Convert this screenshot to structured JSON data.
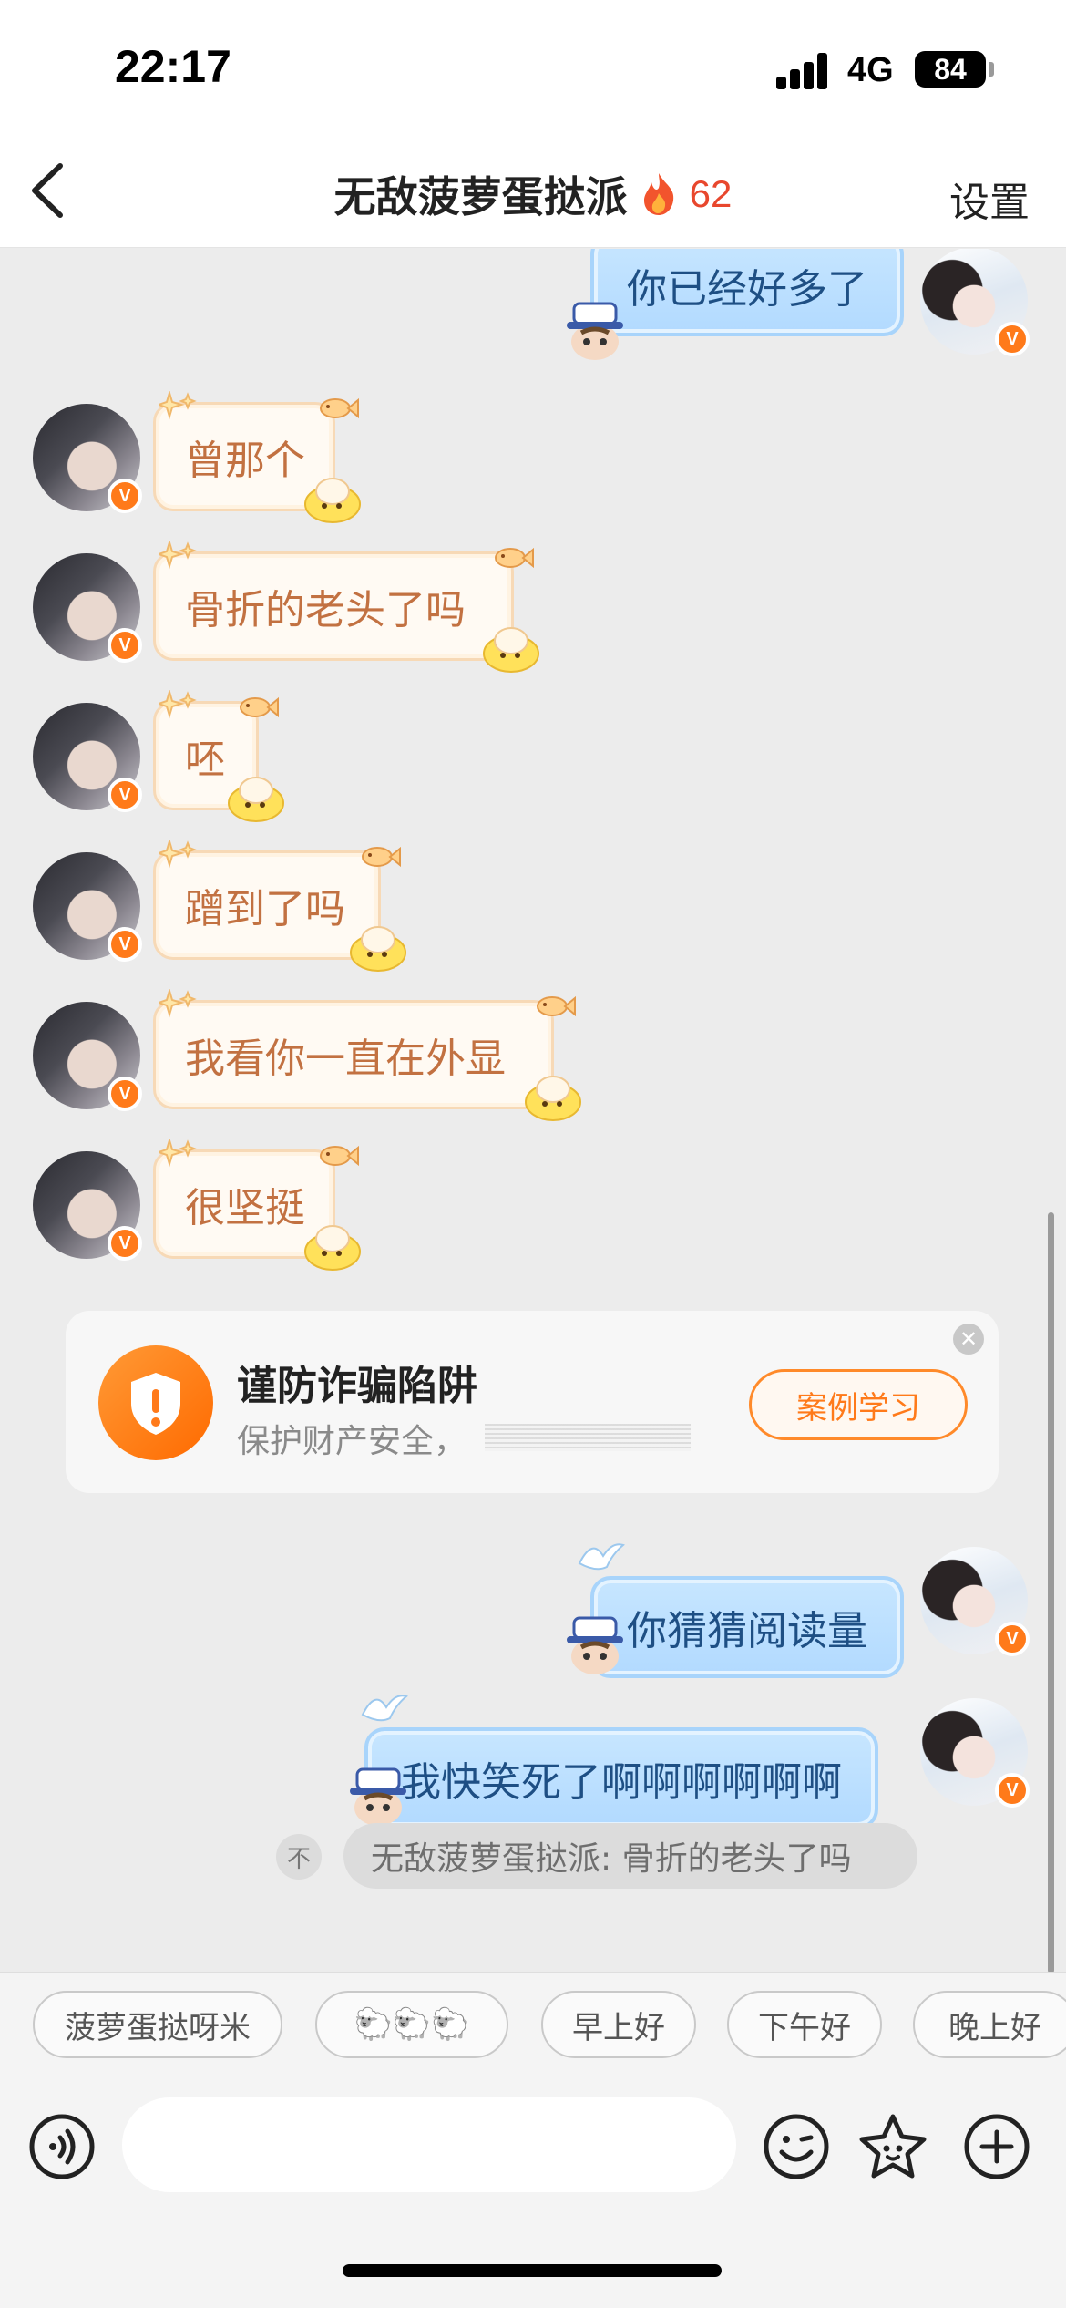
{
  "status_bar": {
    "time": "22:17",
    "network": "4G",
    "battery": "84"
  },
  "nav": {
    "back_icon": "chevron-left-icon",
    "title": "无敌菠萝蛋挞派",
    "fire_icon": "fire-icon",
    "streak": "62",
    "settings_label": "设置"
  },
  "messages": [
    {
      "side": "right",
      "text": "你已经好多了"
    },
    {
      "side": "left",
      "text": "曾那个"
    },
    {
      "side": "left",
      "text": "骨折的老头了吗"
    },
    {
      "side": "left",
      "text": "呸"
    },
    {
      "side": "left",
      "text": "蹭到了吗"
    },
    {
      "side": "left",
      "text": "我看你一直在外显"
    },
    {
      "side": "left",
      "text": "很坚挺"
    },
    {
      "side": "right",
      "text": "你猜猜阅读量"
    },
    {
      "side": "right",
      "text": "我快笑死了啊啊啊啊啊啊"
    }
  ],
  "safety_card": {
    "title": "谨防诈骗陷阱",
    "subtitle": "保护财产安全，",
    "button_label": "案例学习",
    "close_icon": "close-icon",
    "shield_icon": "shield-alert-icon"
  },
  "quote": {
    "text": "无敌菠萝蛋挞派: 骨折的老头了吗",
    "icon": "pin-top-icon",
    "icon_glyph": "不"
  },
  "quick_replies": [
    "菠萝蛋挞呀米",
    "🐑🐑🐑",
    "早上好",
    "下午好",
    "晚上好"
  ],
  "input_bar": {
    "voice_icon": "voice-icon",
    "emoji_icon": "emoji-icon",
    "sticker_icon": "star-sticker-icon",
    "plus_icon": "plus-icon"
  },
  "colors": {
    "accent_orange": "#ff7a1a",
    "left_bubble_text": "#c27141",
    "right_bubble_text": "#1e4f84",
    "streak_red": "#e8472d"
  }
}
